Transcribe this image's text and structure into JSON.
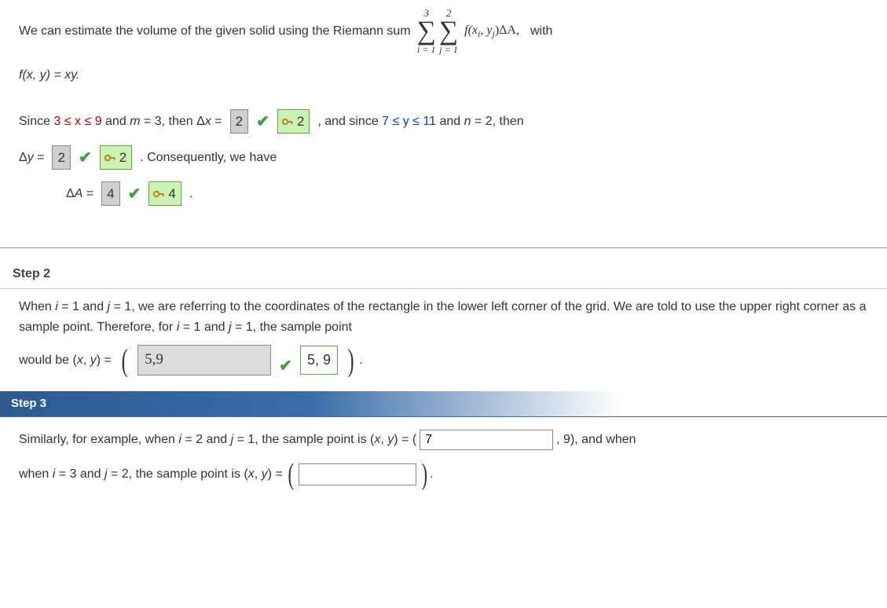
{
  "step1": {
    "intro_a": "We can estimate the volume of the given solid using the Riemann sum ",
    "intro_b": "with",
    "sum_upper1": "3",
    "sum_upper2": "2",
    "sum_lower1": "i = 1",
    "sum_lower2": "j = 1",
    "sum_func": "f(x",
    "sum_func_i": "i",
    "sum_func_mid": ", y",
    "sum_func_j": "j",
    "sum_func_end": ")ΔA,",
    "fxy": "f(x, y) = xy.",
    "since_a1": "Since ",
    "since_a_range": "3 ≤ x ≤ 9",
    "since_a2": " and ",
    "since_a_m": "m",
    "since_a3": " = 3, then Δ",
    "since_a_x": "x",
    "since_a4": " = ",
    "dx_ans": "2",
    "dx_key": "2",
    "since_b1": ", and since ",
    "since_b_range": "7 ≤ y ≤ 11",
    "since_b2": " and ",
    "since_b_n": "n",
    "since_b3": " = 2, then",
    "dy_label_a": "Δ",
    "dy_label_y": "y",
    "dy_label_eq": " = ",
    "dy_ans": "2",
    "dy_key": "2",
    "cons": ". Consequently, we have",
    "dA_label": "ΔA = ",
    "dA_ans": "4",
    "dA_key": "4",
    "period": "."
  },
  "step2": {
    "header": "Step 2",
    "p1": "When i = 1 and j = 1, we are referring to the coordinates of the rectangle in the lower left corner of the grid. We are told to use the upper right corner as a sample point. Therefore, for i = 1 and j = 1, the sample point",
    "p2a": "would be  (",
    "p2_x": "x",
    "p2_comma": ", ",
    "p2_y": "y",
    "p2b": ") = ",
    "ans": "5,9",
    "key": "5, 9",
    "p2c": "."
  },
  "step3": {
    "header": "Step 3",
    "p1a": "Similarly, for example, when ",
    "p1_i": "i",
    "p1b": " = 2 and ",
    "p1_j": "j",
    "p1c": " = 1, the sample point is  (",
    "p1_x": "x",
    "p1_comma": ", ",
    "p1_y": "y",
    "p1d": ") = ( ",
    "input1_val": "7",
    "p1e": ", 9),  and when",
    "p2a": "when ",
    "p2_i": "i",
    "p2b": " = 3 and ",
    "p2_j": "j",
    "p2c": " = 2, the sample point is  (",
    "p2_x": "x",
    "p2_comma": ", ",
    "p2_y": "y",
    "p2d": ") = ",
    "input2_val": "",
    "p2e": "."
  }
}
